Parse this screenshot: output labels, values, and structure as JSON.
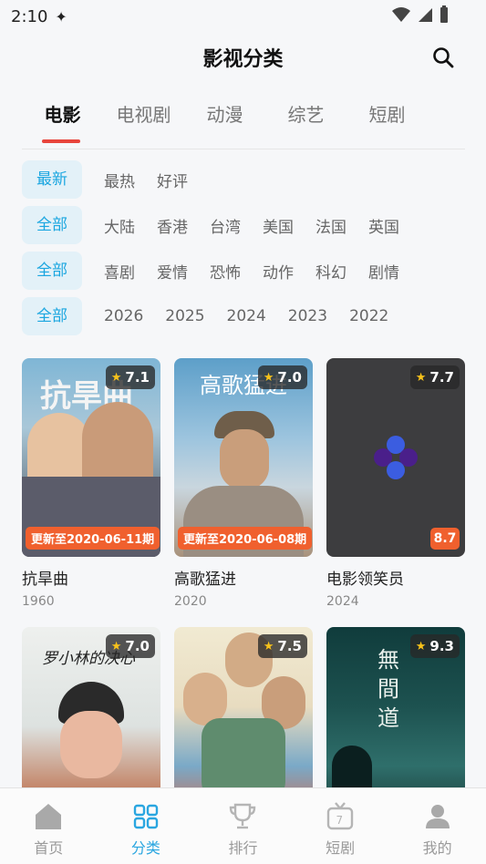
{
  "status": {
    "time": "2:10"
  },
  "header": {
    "title": "影视分类"
  },
  "tabs": [
    {
      "label": "电影"
    },
    {
      "label": "电视剧"
    },
    {
      "label": "动漫"
    },
    {
      "label": "综艺"
    },
    {
      "label": "短剧"
    }
  ],
  "filters": {
    "sort": [
      "最新",
      "最热",
      "好评"
    ],
    "region": [
      "全部",
      "大陆",
      "香港",
      "台湾",
      "美国",
      "法国",
      "英国"
    ],
    "genre": [
      "全部",
      "喜剧",
      "爱情",
      "恐怖",
      "动作",
      "科幻",
      "剧情"
    ],
    "year": [
      "全部",
      "2026",
      "2025",
      "2024",
      "2023",
      "2022"
    ]
  },
  "movies": [
    {
      "title": "抗旱曲",
      "year": "1960",
      "rating": "7.1",
      "update": "更新至2020-06-11期",
      "poster_text": "抗旱曲"
    },
    {
      "title": "高歌猛进",
      "year": "2020",
      "rating": "7.0",
      "update": "更新至2020-06-08期",
      "poster_text": "高歌猛进"
    },
    {
      "title": "电影领笑员",
      "year": "2024",
      "rating": "7.7",
      "score": "8.7"
    },
    {
      "title": "",
      "year": "",
      "rating": "7.0",
      "poster_text": "罗小林的决心"
    },
    {
      "title": "",
      "year": "",
      "rating": "7.5",
      "poster_text": ""
    },
    {
      "title": "",
      "year": "",
      "rating": "9.3",
      "poster_text": "無間道"
    }
  ],
  "nav": [
    {
      "label": "首页"
    },
    {
      "label": "分类"
    },
    {
      "label": "排行"
    },
    {
      "label": "短剧"
    },
    {
      "label": "我的"
    }
  ],
  "colors": {
    "accent": "#2aa6e0",
    "tab_underline": "#e8453c",
    "badge": "#f0602e",
    "chip_bg": "#e3f1f8"
  }
}
